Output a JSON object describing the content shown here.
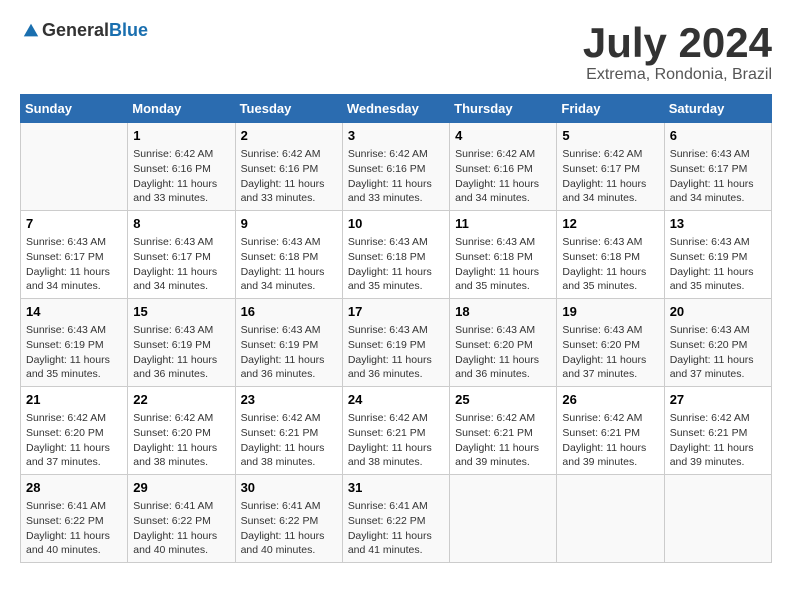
{
  "header": {
    "logo_general": "General",
    "logo_blue": "Blue",
    "title": "July 2024",
    "subtitle": "Extrema, Rondonia, Brazil"
  },
  "days_of_week": [
    "Sunday",
    "Monday",
    "Tuesday",
    "Wednesday",
    "Thursday",
    "Friday",
    "Saturday"
  ],
  "weeks": [
    [
      {
        "day": "",
        "info": ""
      },
      {
        "day": "1",
        "info": "Sunrise: 6:42 AM\nSunset: 6:16 PM\nDaylight: 11 hours\nand 33 minutes."
      },
      {
        "day": "2",
        "info": "Sunrise: 6:42 AM\nSunset: 6:16 PM\nDaylight: 11 hours\nand 33 minutes."
      },
      {
        "day": "3",
        "info": "Sunrise: 6:42 AM\nSunset: 6:16 PM\nDaylight: 11 hours\nand 33 minutes."
      },
      {
        "day": "4",
        "info": "Sunrise: 6:42 AM\nSunset: 6:16 PM\nDaylight: 11 hours\nand 34 minutes."
      },
      {
        "day": "5",
        "info": "Sunrise: 6:42 AM\nSunset: 6:17 PM\nDaylight: 11 hours\nand 34 minutes."
      },
      {
        "day": "6",
        "info": "Sunrise: 6:43 AM\nSunset: 6:17 PM\nDaylight: 11 hours\nand 34 minutes."
      }
    ],
    [
      {
        "day": "7",
        "info": "Sunrise: 6:43 AM\nSunset: 6:17 PM\nDaylight: 11 hours\nand 34 minutes."
      },
      {
        "day": "8",
        "info": "Sunrise: 6:43 AM\nSunset: 6:17 PM\nDaylight: 11 hours\nand 34 minutes."
      },
      {
        "day": "9",
        "info": "Sunrise: 6:43 AM\nSunset: 6:18 PM\nDaylight: 11 hours\nand 34 minutes."
      },
      {
        "day": "10",
        "info": "Sunrise: 6:43 AM\nSunset: 6:18 PM\nDaylight: 11 hours\nand 35 minutes."
      },
      {
        "day": "11",
        "info": "Sunrise: 6:43 AM\nSunset: 6:18 PM\nDaylight: 11 hours\nand 35 minutes."
      },
      {
        "day": "12",
        "info": "Sunrise: 6:43 AM\nSunset: 6:18 PM\nDaylight: 11 hours\nand 35 minutes."
      },
      {
        "day": "13",
        "info": "Sunrise: 6:43 AM\nSunset: 6:19 PM\nDaylight: 11 hours\nand 35 minutes."
      }
    ],
    [
      {
        "day": "14",
        "info": "Sunrise: 6:43 AM\nSunset: 6:19 PM\nDaylight: 11 hours\nand 35 minutes."
      },
      {
        "day": "15",
        "info": "Sunrise: 6:43 AM\nSunset: 6:19 PM\nDaylight: 11 hours\nand 36 minutes."
      },
      {
        "day": "16",
        "info": "Sunrise: 6:43 AM\nSunset: 6:19 PM\nDaylight: 11 hours\nand 36 minutes."
      },
      {
        "day": "17",
        "info": "Sunrise: 6:43 AM\nSunset: 6:19 PM\nDaylight: 11 hours\nand 36 minutes."
      },
      {
        "day": "18",
        "info": "Sunrise: 6:43 AM\nSunset: 6:20 PM\nDaylight: 11 hours\nand 36 minutes."
      },
      {
        "day": "19",
        "info": "Sunrise: 6:43 AM\nSunset: 6:20 PM\nDaylight: 11 hours\nand 37 minutes."
      },
      {
        "day": "20",
        "info": "Sunrise: 6:43 AM\nSunset: 6:20 PM\nDaylight: 11 hours\nand 37 minutes."
      }
    ],
    [
      {
        "day": "21",
        "info": "Sunrise: 6:42 AM\nSunset: 6:20 PM\nDaylight: 11 hours\nand 37 minutes."
      },
      {
        "day": "22",
        "info": "Sunrise: 6:42 AM\nSunset: 6:20 PM\nDaylight: 11 hours\nand 38 minutes."
      },
      {
        "day": "23",
        "info": "Sunrise: 6:42 AM\nSunset: 6:21 PM\nDaylight: 11 hours\nand 38 minutes."
      },
      {
        "day": "24",
        "info": "Sunrise: 6:42 AM\nSunset: 6:21 PM\nDaylight: 11 hours\nand 38 minutes."
      },
      {
        "day": "25",
        "info": "Sunrise: 6:42 AM\nSunset: 6:21 PM\nDaylight: 11 hours\nand 39 minutes."
      },
      {
        "day": "26",
        "info": "Sunrise: 6:42 AM\nSunset: 6:21 PM\nDaylight: 11 hours\nand 39 minutes."
      },
      {
        "day": "27",
        "info": "Sunrise: 6:42 AM\nSunset: 6:21 PM\nDaylight: 11 hours\nand 39 minutes."
      }
    ],
    [
      {
        "day": "28",
        "info": "Sunrise: 6:41 AM\nSunset: 6:22 PM\nDaylight: 11 hours\nand 40 minutes."
      },
      {
        "day": "29",
        "info": "Sunrise: 6:41 AM\nSunset: 6:22 PM\nDaylight: 11 hours\nand 40 minutes."
      },
      {
        "day": "30",
        "info": "Sunrise: 6:41 AM\nSunset: 6:22 PM\nDaylight: 11 hours\nand 40 minutes."
      },
      {
        "day": "31",
        "info": "Sunrise: 6:41 AM\nSunset: 6:22 PM\nDaylight: 11 hours\nand 41 minutes."
      },
      {
        "day": "",
        "info": ""
      },
      {
        "day": "",
        "info": ""
      },
      {
        "day": "",
        "info": ""
      }
    ]
  ]
}
